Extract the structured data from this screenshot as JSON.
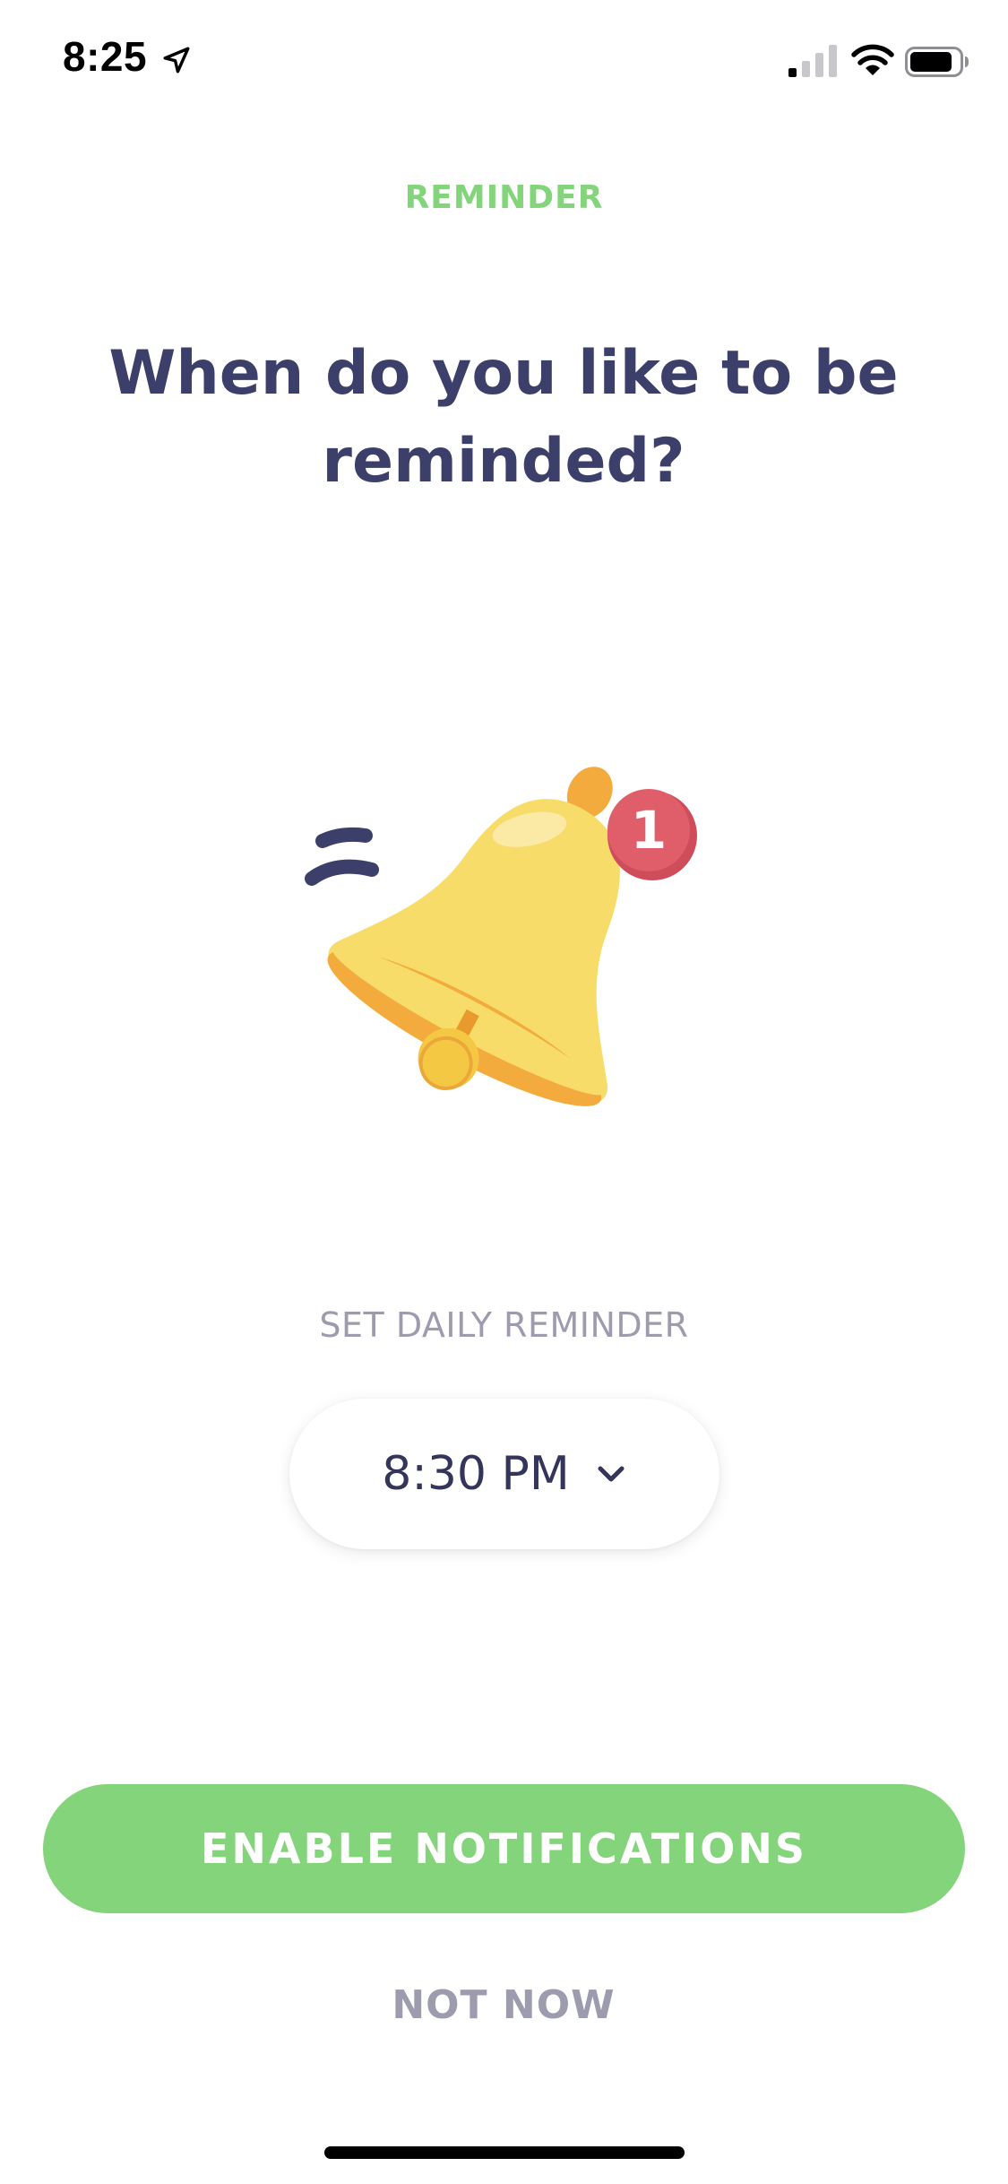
{
  "status_bar": {
    "time": "8:25",
    "icons": [
      "location-arrow-icon",
      "cellular-signal-icon",
      "wifi-icon",
      "battery-icon"
    ]
  },
  "header": {
    "eyebrow": "REMINDER",
    "title": "When do you like to be reminded?"
  },
  "illustration": {
    "icon": "bell-icon",
    "badge_count": "1"
  },
  "reminder": {
    "label": "SET DAILY REMINDER",
    "time": "8:30 PM",
    "icon": "chevron-down-icon"
  },
  "actions": {
    "enable_label": "ENABLE NOTIFICATIONS",
    "skip_label": "NOT NOW"
  },
  "colors": {
    "accent_green": "#83d47a",
    "title_navy": "#3d3f6b",
    "muted_gray": "#9d9cae",
    "bell_yellow": "#f8dc6a",
    "bell_orange": "#f2ab3c",
    "badge_red": "#e05d6a"
  }
}
